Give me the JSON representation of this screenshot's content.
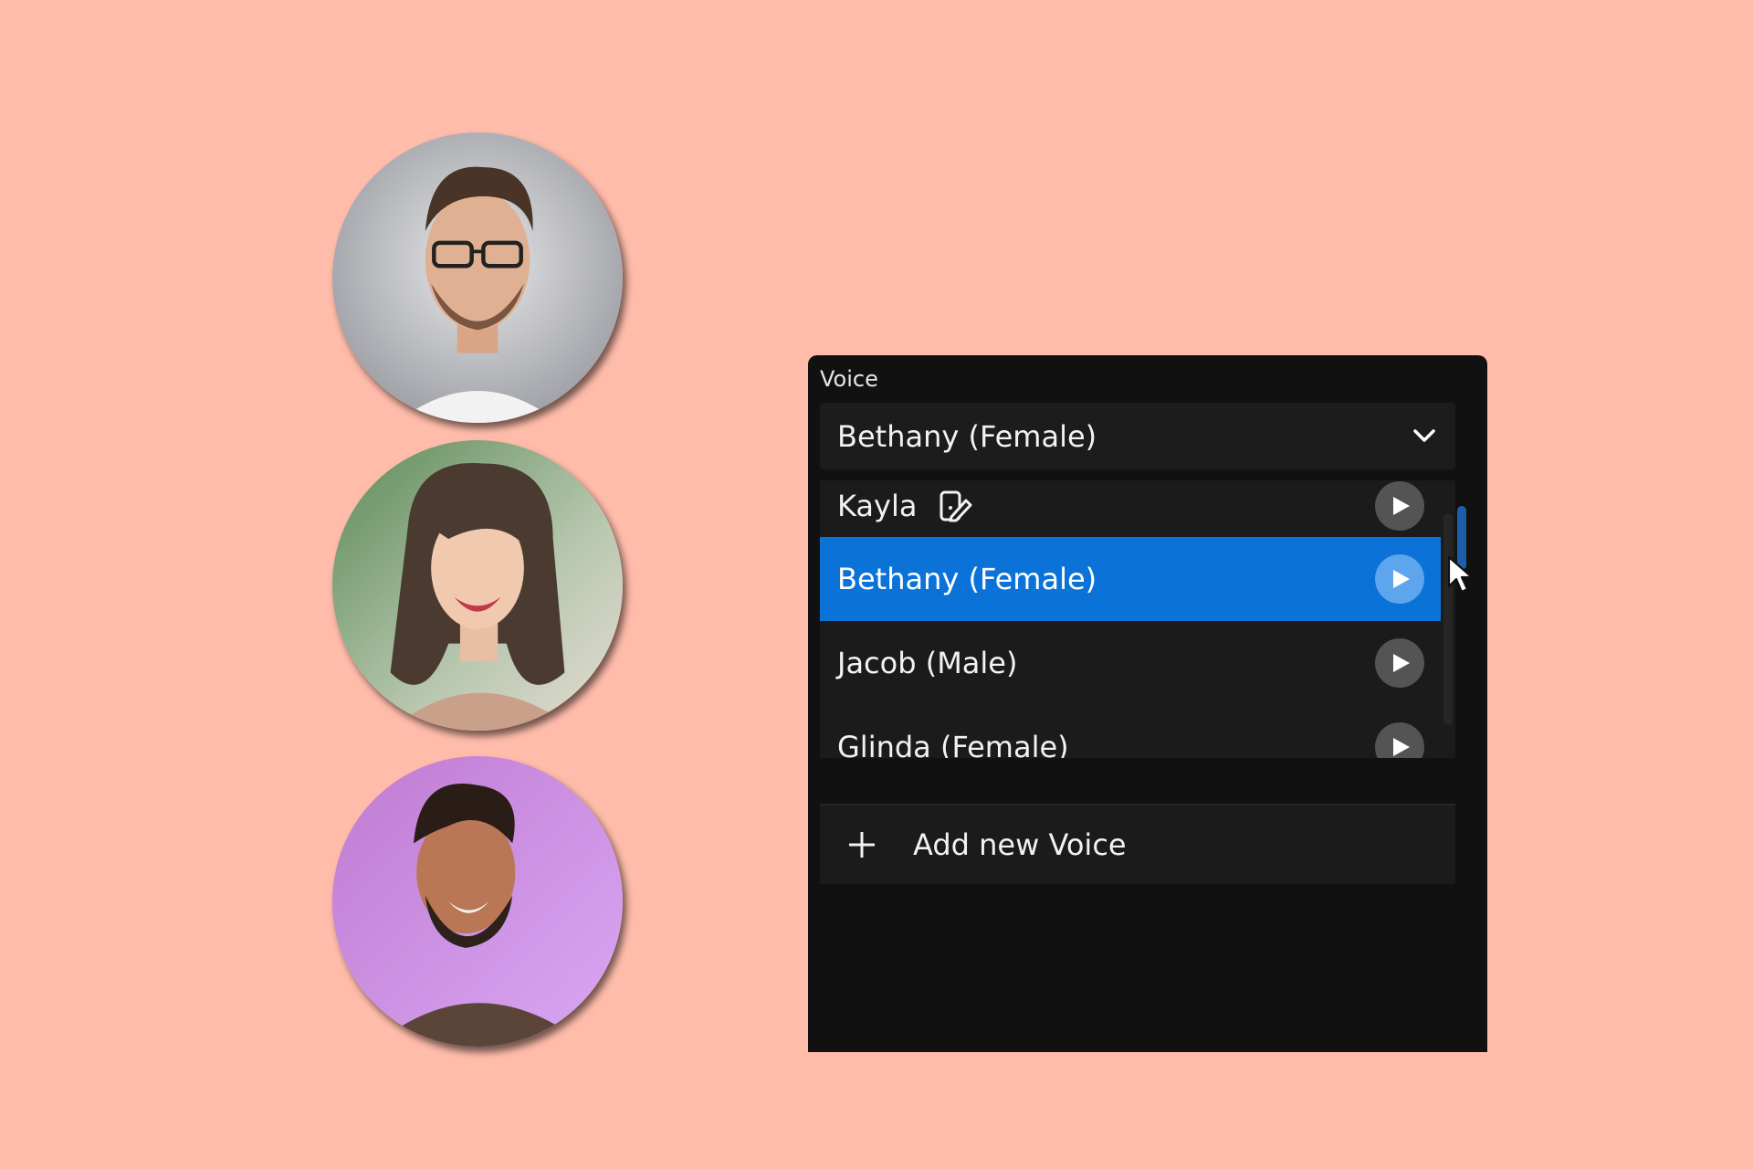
{
  "panel": {
    "label": "Voice",
    "selected_value": "Bethany (Female)"
  },
  "voices": [
    {
      "name": "Kayla",
      "has_edit_icon": true
    },
    {
      "name": "Bethany (Female)",
      "selected": true
    },
    {
      "name": "Jacob (Male)"
    },
    {
      "name": "Glinda (Female)"
    }
  ],
  "add_voice_label": "Add new Voice",
  "icons": {
    "dropdown": "chevron-down-icon",
    "play": "play-icon",
    "edit": "edit-voice-icon",
    "add": "plus-icon",
    "cursor": "mouse-pointer-icon"
  },
  "colors": {
    "background": "#ffbcab",
    "panel": "#111111",
    "accent": "#0b73d8"
  }
}
